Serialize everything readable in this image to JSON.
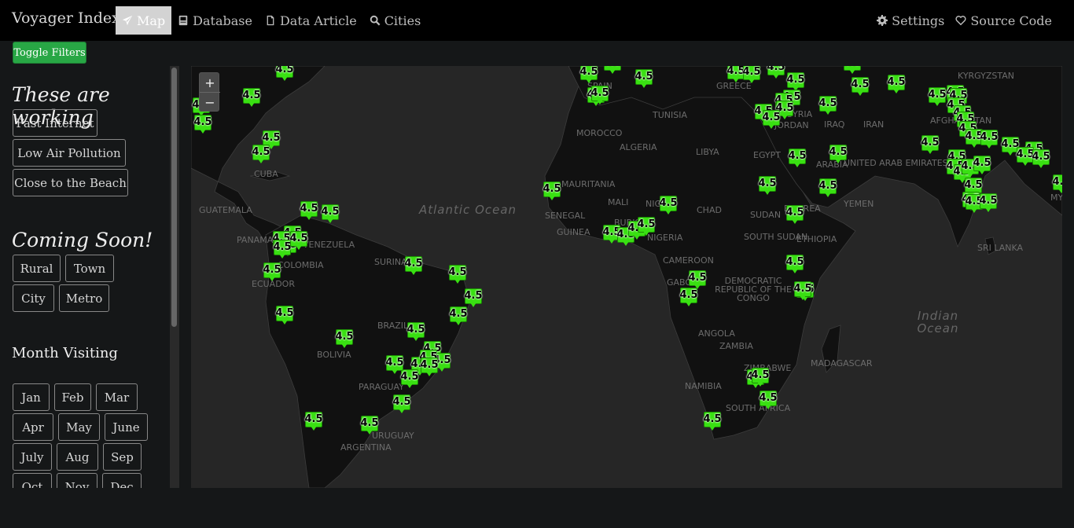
{
  "header": {
    "brand": "Voyager Index",
    "nav": [
      {
        "label": "Map",
        "icon": "paper-plane-icon",
        "active": true
      },
      {
        "label": "Database",
        "icon": "database-icon",
        "active": false
      },
      {
        "label": "Data Article",
        "icon": "document-icon",
        "active": false
      },
      {
        "label": "Cities",
        "icon": "search-icon",
        "active": false
      }
    ],
    "right": [
      {
        "label": "Settings",
        "icon": "gear-icon"
      },
      {
        "label": "Source Code",
        "icon": "heart-icon"
      }
    ]
  },
  "toggle_filters": "Toggle Filters",
  "sidebar": {
    "working_title": "These are working",
    "working": [
      "Fast Internet",
      "Low Air Pollution",
      "Close to the Beach"
    ],
    "soon_title": "Coming Soon!",
    "soon": [
      "Rural",
      "Town",
      "City",
      "Metro"
    ],
    "month_title": "Month Visiting",
    "months": [
      "Jan",
      "Feb",
      "Mar",
      "Apr",
      "May",
      "June",
      "July",
      "Aug",
      "Sep",
      "Oct",
      "Nov",
      "Dec"
    ]
  },
  "map": {
    "zoom_in": "+",
    "zoom_out": "−",
    "marker_value": "4.5",
    "oceans": [
      "Atlantic Ocean",
      "Indian Ocean"
    ],
    "countries": [
      "MOROCCO",
      "ALGERIA",
      "LIBYA",
      "EGYPT",
      "TUNISIA",
      "MAURITANIA",
      "MALI",
      "NIGER",
      "CHAD",
      "SUDAN",
      "SENEGAL",
      "GUINEA",
      "BURKINA",
      "NIGERIA",
      "CAMEROON",
      "ETHIOPIA",
      "SOUTH SUDAN",
      "ERITREA",
      "GABON",
      "DEMOCRATIC REPUBLIC OF THE CONGO",
      "ANGOLA",
      "ZAMBIA",
      "NAMIBIA",
      "SOUTH AFRICA",
      "MADAGASCAR",
      "ZIMBABWE",
      "VENEZUELA",
      "COLOMBIA",
      "ECUADOR",
      "SURINAME",
      "BRAZIL",
      "BOLIVIA",
      "PARAGUAY",
      "ARGENTINA",
      "URUGUAY",
      "GUATEMALA",
      "PANAMA",
      "CUBA",
      "IRAQ",
      "IRAN",
      "AFGHANISTAN",
      "KYRGYZSTAN",
      "UNITED ARAB EMIRATES",
      "YEMEN",
      "SRI LANKA",
      "SPAIN",
      "GREECE",
      "SYRIA",
      "JORDAN",
      "ARABIA",
      "MYANMAR"
    ]
  },
  "colors": {
    "marker": "#39e012",
    "toggle": "#28a745",
    "land": "#121212",
    "sea": "#262626"
  }
}
